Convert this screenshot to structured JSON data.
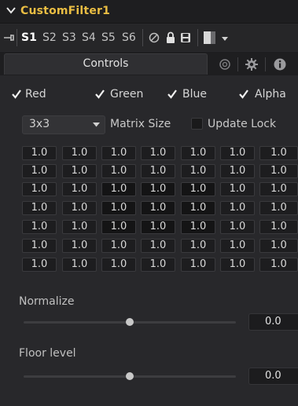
{
  "header": {
    "title": "CustomFilter1"
  },
  "toolbar": {
    "slots": [
      "S1",
      "S2",
      "S3",
      "S4",
      "S5",
      "S6"
    ],
    "active_slot": "S1"
  },
  "tabs": {
    "controls_label": "Controls"
  },
  "channels": [
    {
      "label": "Red",
      "checked": true
    },
    {
      "label": "Green",
      "checked": true
    },
    {
      "label": "Blue",
      "checked": true
    },
    {
      "label": "Alpha",
      "checked": true
    }
  ],
  "matrix_size": {
    "value": "3x3",
    "label": "Matrix Size"
  },
  "update_lock": {
    "label": "Update Lock",
    "checked": false
  },
  "matrix": [
    [
      "1.0",
      "1.0",
      "1.0",
      "1.0",
      "1.0",
      "1.0",
      "1.0"
    ],
    [
      "1.0",
      "1.0",
      "1.0",
      "1.0",
      "1.0",
      "1.0",
      "1.0"
    ],
    [
      "1.0",
      "1.0",
      "1.0",
      "1.0",
      "1.0",
      "1.0",
      "1.0"
    ],
    [
      "1.0",
      "1.0",
      "1.0",
      "1.0",
      "1.0",
      "1.0",
      "1.0"
    ],
    [
      "1.0",
      "1.0",
      "1.0",
      "1.0",
      "1.0",
      "1.0",
      "1.0"
    ],
    [
      "1.0",
      "1.0",
      "1.0",
      "1.0",
      "1.0",
      "1.0",
      "1.0"
    ],
    [
      "1.0",
      "1.0",
      "1.0",
      "1.0",
      "1.0",
      "1.0",
      "1.0"
    ]
  ],
  "normalize": {
    "label": "Normalize",
    "value": "0.0",
    "slider_fraction": 0.5
  },
  "floor_level": {
    "label": "Floor level",
    "value": "0.0",
    "slider_fraction": 0.5
  },
  "colors": {
    "title": "#e9bd43",
    "background": "#28282b",
    "cell_background": "#1d1d1f"
  }
}
